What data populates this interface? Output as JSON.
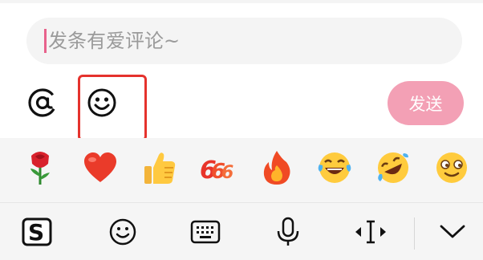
{
  "comment": {
    "placeholder": "发条有爱评论~",
    "send_label": "发送"
  },
  "toolbar": {
    "at_icon": "at-icon",
    "emoji_icon": "smiley-icon"
  },
  "emoji_row": {
    "items": [
      "rose-emoji",
      "heart-emoji",
      "thumbs-up-emoji",
      "666-emoji",
      "fire-emoji",
      "laugh-tears-emoji",
      "rolling-laugh-emoji",
      "squint-smile-emoji"
    ]
  },
  "keyboard_bar": {
    "items": [
      "sogou-logo-icon",
      "smiley-icon",
      "keyboard-icon",
      "microphone-icon",
      "cursor-move-icon",
      "chevron-down-icon"
    ]
  },
  "colors": {
    "send_button": "#f3a0b5",
    "caret": "#e8628c",
    "highlight_box": "#e5322d"
  }
}
